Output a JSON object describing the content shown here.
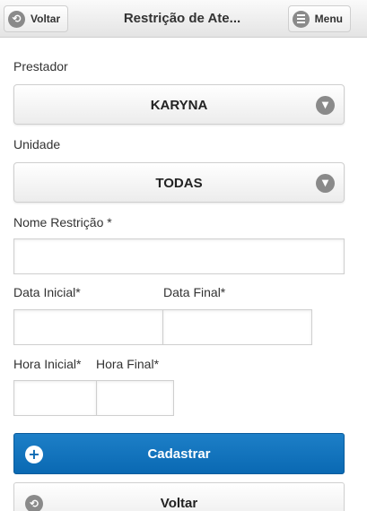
{
  "header": {
    "back_label": "Voltar",
    "title": "Restrição de Ate...",
    "menu_label": "Menu"
  },
  "form": {
    "prestador_label": "Prestador",
    "prestador_value": "KARYNA",
    "unidade_label": "Unidade",
    "unidade_value": "TODAS",
    "nome_label": "Nome Restrição *",
    "nome_value": "",
    "data_inicial_label": "Data Inicial*",
    "data_inicial_value": "",
    "data_final_label": "Data Final*",
    "data_final_value": "",
    "hora_inicial_label": "Hora Inicial*",
    "hora_inicial_value": "",
    "hora_final_label": "Hora Final*",
    "hora_final_value": ""
  },
  "actions": {
    "submit_label": "Cadastrar",
    "back_label": "Voltar"
  },
  "colors": {
    "primary": "#0a69b3",
    "icon_gray": "#8a8a8a"
  },
  "icons": {
    "header_back": "arrow-left-circle-icon",
    "header_menu": "hamburger-icon",
    "select_chevron": "chevron-down-icon",
    "submit": "plus-icon",
    "back": "arrow-left-circle-icon"
  }
}
